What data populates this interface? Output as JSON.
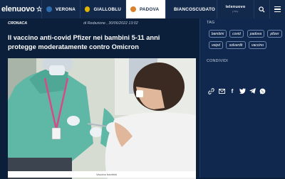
{
  "header": {
    "logo": "elenuovo",
    "tabs": [
      {
        "label": "VERONA",
        "dot_color": "#2b6cb0"
      },
      {
        "label": "GIALLOBLU",
        "dot_color": "#e1b400"
      },
      {
        "label": "PADOVA",
        "dot_color": "#d9822b"
      },
      {
        "label": "BIANCOSCUDATO",
        "dot_color": "#c0392b"
      }
    ],
    "tv_label": "telenuovo",
    "tv_sub": "play"
  },
  "article": {
    "category": "CRONACA",
    "byline": "di Redazione , 30/06/2022 13:02",
    "title_line1": "Il vaccino anti-covid Pfizer nei bambini 5-11 anni",
    "title_line2": "protegge moderatamente contro Omicron",
    "caption": "Vaccino bambini"
  },
  "sidebar": {
    "tag_heading": "TAG",
    "tags": [
      "bambini",
      "covid",
      "padova",
      "pfizer",
      "veipd",
      "solverdit",
      "vaccino"
    ],
    "share_heading": "CONDIVIDI"
  },
  "colors": {
    "header_bg": "#13294b",
    "page_bg": "#0b1f3a",
    "active_tab_bg": "#ffffff"
  }
}
